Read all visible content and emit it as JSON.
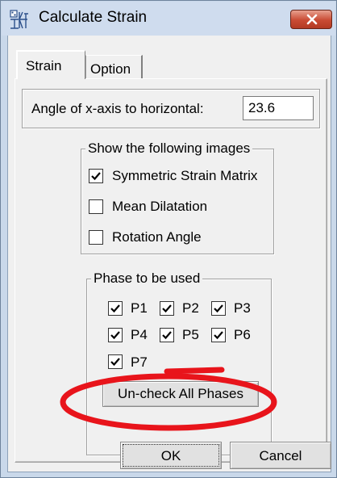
{
  "window": {
    "title": "Calculate Strain",
    "app_icon": "strain-app-icon",
    "close_icon": "close-x-icon"
  },
  "tabs": [
    {
      "label": "Strain",
      "selected": true
    },
    {
      "label": "Option",
      "selected": false
    }
  ],
  "angle": {
    "label": "Angle of x-axis to horizontal:",
    "value": "23.6"
  },
  "images_group": {
    "title": "Show the following images",
    "items": [
      {
        "label": "Symmetric Strain Matrix",
        "checked": true
      },
      {
        "label": "Mean Dilatation",
        "checked": false
      },
      {
        "label": "Rotation Angle",
        "checked": false
      }
    ]
  },
  "phase_group": {
    "title": "Phase to be used",
    "phases": [
      {
        "label": "P1",
        "checked": true
      },
      {
        "label": "P2",
        "checked": true
      },
      {
        "label": "P3",
        "checked": true
      },
      {
        "label": "P4",
        "checked": true
      },
      {
        "label": "P5",
        "checked": true
      },
      {
        "label": "P6",
        "checked": true
      },
      {
        "label": "P7",
        "checked": true
      }
    ],
    "uncheck_label": "Un-check All Phases"
  },
  "buttons": {
    "ok": "OK",
    "cancel": "Cancel"
  },
  "annotation": {
    "color": "#e8141b"
  }
}
